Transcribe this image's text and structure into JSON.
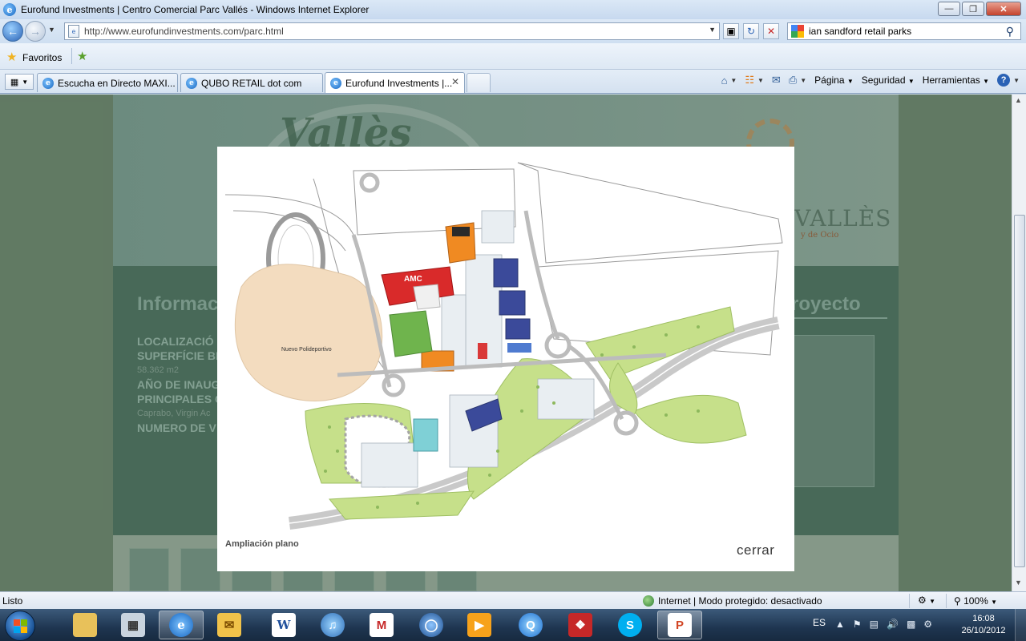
{
  "window": {
    "title": "Eurofund Investments | Centro Comercial Parc Vallés - Windows Internet Explorer",
    "controls": [
      "—",
      "❐",
      "✕"
    ]
  },
  "address": {
    "url": "http://www.eurofundinvestments.com/parc.html",
    "search_value": "ian sandford retail parks"
  },
  "favorites": {
    "label": "Favoritos"
  },
  "tabs": [
    {
      "label": "Escucha en Directo MAXI..."
    },
    {
      "label": "QUBO RETAIL dot com"
    },
    {
      "label": "Eurofund Investments |..."
    }
  ],
  "command_bar": {
    "page_label": "Página",
    "safety_label": "Seguridad",
    "tools_label": "Herramientas"
  },
  "site": {
    "banner_name": "Vallès",
    "brand": "VALLÈS",
    "brand_sub": "y de Ocio",
    "info_heading": "Informac",
    "project_heading": "royecto",
    "info_lines": [
      "LOCALIZACIÓ",
      "SUPERFÍCIE BR",
      "58.362 m2",
      "AÑO DE INAUG",
      "PRINCIPALES C",
      "Caprabo, Virgin Ac",
      "NUMERO DE V"
    ]
  },
  "modal": {
    "caption": "Ampliación plano",
    "close_label": "cerrar",
    "map_labels": {
      "sports_center": "Nuevo Polideportivo",
      "cinema": "AMC"
    }
  },
  "status": {
    "left": "Listo",
    "zone": "Internet | Modo protegido: desactivado",
    "zoom": "100%"
  },
  "taskbar": {
    "language": "ES",
    "time": "16:08",
    "date": "26/10/2012"
  },
  "colors": {
    "map_green": "#c6e08a",
    "map_sand": "#f3dcbf",
    "amc_red": "#d92a2a",
    "store_blue": "#3b4a9a",
    "store_orange": "#f08a22",
    "overlay_teal": "#4d7463"
  }
}
